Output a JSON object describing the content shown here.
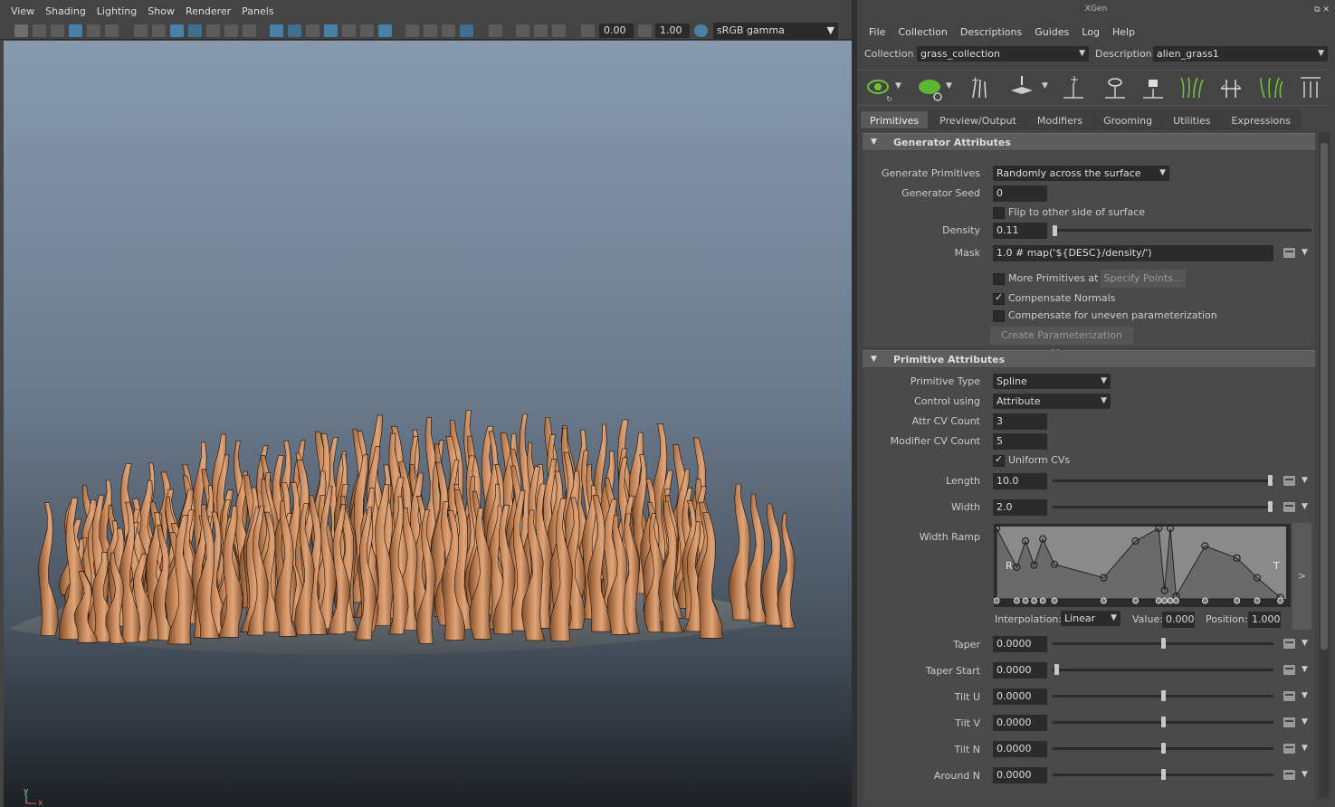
{
  "viewport": {
    "menus": [
      "View",
      "Shading",
      "Lighting",
      "Show",
      "Renderer",
      "Panels"
    ],
    "exposure": "0.00",
    "gamma": "1.00",
    "colorspace": "sRGB gamma",
    "axis_y": "y",
    "axis_x": "x"
  },
  "xgen": {
    "title": "XGen",
    "menus": [
      "File",
      "Collection",
      "Descriptions",
      "Guides",
      "Log",
      "Help"
    ],
    "collection_label": "Collection",
    "collection_value": "grass_collection",
    "description_label": "Description",
    "description_value": "alien_grass1",
    "tabs": [
      "Primitives",
      "Preview/Output",
      "Modifiers",
      "Grooming",
      "Utilities",
      "Expressions"
    ],
    "generator": {
      "title": "Generator Attributes",
      "generate_label": "Generate Primitives",
      "generate_value": "Randomly across the surface",
      "seed_label": "Generator Seed",
      "seed_value": "0",
      "flip_label": "Flip to other side of surface",
      "density_label": "Density",
      "density_value": "0.11",
      "mask_label": "Mask",
      "mask_value": "1.0 # map('${DESC}/density/')",
      "more_label": "More Primitives at",
      "specify_label": "Specify Points...",
      "comp_normals_label": "Compensate Normals",
      "comp_uneven_label": "Compensate for uneven parameterization",
      "create_map_label": "Create Parameterization Map"
    },
    "primitive": {
      "title": "Primitive Attributes",
      "type_label": "Primitive Type",
      "type_value": "Spline",
      "control_label": "Control using",
      "control_value": "Attribute",
      "attr_cv_label": "Attr CV Count",
      "attr_cv_value": "3",
      "mod_cv_label": "Modifier CV Count",
      "mod_cv_value": "5",
      "uniform_label": "Uniform CVs",
      "length_label": "Length",
      "length_value": "10.0",
      "width_label": "Width",
      "width_value": "2.0",
      "ramp_label": "Width Ramp",
      "ramp_r": "R",
      "ramp_t": "T",
      "interp_label": "Interpolation:",
      "interp_value": "Linear",
      "value_label": "Value:",
      "value_value": "0.000",
      "position_label": "Position:",
      "position_value": "1.000",
      "taper_label": "Taper",
      "taper_value": "0.0000",
      "taper_start_label": "Taper Start",
      "taper_start_value": "0.0000",
      "tilt_u_label": "Tilt U",
      "tilt_u_value": "0.0000",
      "tilt_v_label": "Tilt V",
      "tilt_v_value": "0.0000",
      "tilt_n_label": "Tilt N",
      "tilt_n_value": "0.0000",
      "around_n_label": "Around N",
      "around_n_value": "0.0000"
    }
  }
}
